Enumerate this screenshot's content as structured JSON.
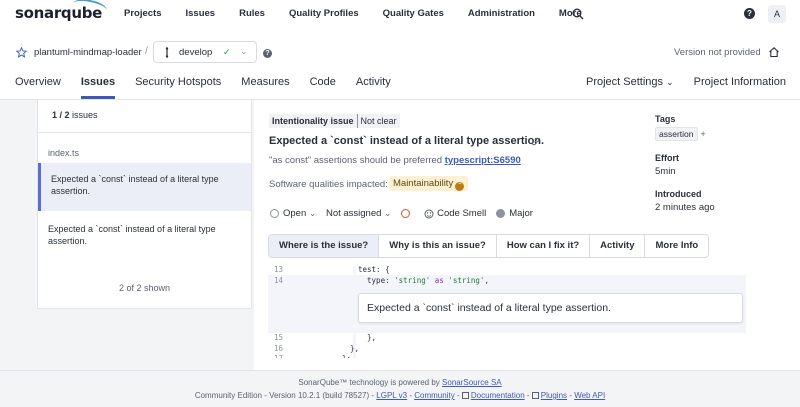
{
  "app": {
    "logo": "sonarqube",
    "nav": [
      "Projects",
      "Issues",
      "Rules",
      "Quality Profiles",
      "Quality Gates",
      "Administration",
      "More"
    ],
    "avatar": "A"
  },
  "project": {
    "name": "plantuml-mindmap-loader",
    "separator": "/",
    "branch": "develop",
    "branch_status": "✓",
    "version": "Version not provided"
  },
  "tabs": [
    "Overview",
    "Issues",
    "Security Hotspots",
    "Measures",
    "Code",
    "Activity"
  ],
  "tabs_right": [
    "Project Settings",
    "Project Information"
  ],
  "issues_panel": {
    "count_current": "1 / 2",
    "count_label": "issues",
    "file": "index.ts",
    "items": [
      "Expected a `const` instead of a literal type assertion.",
      "Expected a `const` instead of a literal type assertion."
    ],
    "shown": "2 of 2 shown"
  },
  "issue": {
    "attr_primary": "Intentionality issue",
    "attr_secondary": "Not clear",
    "title": "Expected a `const` instead of a literal type assertion.",
    "description": "\"as const\" assertions should be preferred",
    "rule_key": "typescript:S6590",
    "qualities_label": "Software qualities impacted:",
    "quality": "Maintainability",
    "status": "Open",
    "assignee": "Not assigned",
    "type": "Code Smell",
    "severity": "Major",
    "tags_label": "Tags",
    "tag": "assertion",
    "tag_add": "+",
    "effort_label": "Effort",
    "effort": "5min",
    "introduced_label": "Introduced",
    "introduced": "2 minutes ago"
  },
  "subtabs": [
    "Where is the issue?",
    "Why is this an issue?",
    "How can I fix it?",
    "Activity",
    "More Info"
  ],
  "code": {
    "lines": [
      {
        "num": "13",
        "text": "test: {"
      },
      {
        "num": "14",
        "pre": "  type: ",
        "str": "'string'",
        "kw": " as ",
        "str2": "'string'",
        "post": ","
      },
      {
        "num": "15",
        "text": "  },"
      },
      {
        "num": "16",
        "text": "},"
      },
      {
        "num": "17",
        "text": "};"
      }
    ],
    "issue_message": "Expected a `const` instead of a literal type assertion."
  },
  "footer": {
    "line1_prefix": "SonarQube™ technology is powered by",
    "line1_link": "SonarSource SA",
    "edition": "Community Edition - Version 10.2.1 (build 78527) -",
    "lgpl": "LGPL v3",
    "community": "Community",
    "documentation": "Documentation",
    "plugins": "Plugins",
    "webapi": "Web API",
    "sep": "-"
  }
}
